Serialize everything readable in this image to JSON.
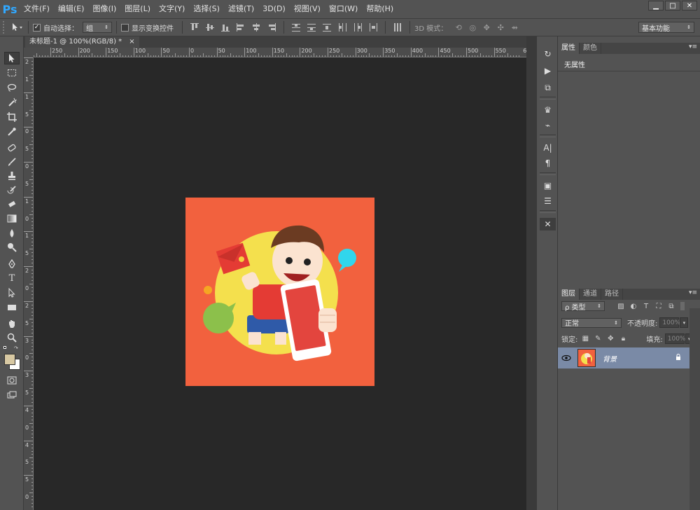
{
  "app": {
    "logo": "Ps"
  },
  "menu": [
    "文件(F)",
    "编辑(E)",
    "图像(I)",
    "图层(L)",
    "文字(Y)",
    "选择(S)",
    "滤镜(T)",
    "3D(D)",
    "视图(V)",
    "窗口(W)",
    "帮助(H)"
  ],
  "window_controls": {
    "minimize": "▁",
    "maximize": "□",
    "close": "✕"
  },
  "options": {
    "auto_select_label": "自动选择：",
    "auto_select_value": "组",
    "show_transform_label": "显示变换控件",
    "mode_3d_label": "3D 模式：",
    "workspace": "基本功能"
  },
  "document": {
    "tab_title": "未标题-1 @ 100%(RGB/8) *",
    "tab_close": "×"
  },
  "ruler": {
    "top_labels": [
      "250",
      "200",
      "150",
      "100",
      "50",
      "0",
      "50",
      "100",
      "150",
      "200",
      "250",
      "300",
      "350",
      "400",
      "450",
      "500",
      "550",
      "60"
    ],
    "left_labels": [
      "2",
      "1",
      "1",
      "5",
      "0",
      "5",
      "0",
      "5",
      "1",
      "0",
      "1",
      "5",
      "2",
      "0",
      "2",
      "5",
      "3",
      "0",
      "3",
      "5",
      "4",
      "0",
      "4",
      "5",
      "5",
      "0"
    ]
  },
  "panels": {
    "properties": {
      "tabs": [
        "属性",
        "颜色"
      ],
      "content": "无属性"
    },
    "layers": {
      "tabs": [
        "图层",
        "通道",
        "路径"
      ],
      "filter_label": "ρ 类型",
      "blend_mode": "正常",
      "opacity_label": "不透明度:",
      "opacity_value": "100%",
      "lock_label": "锁定:",
      "fill_label": "填充:",
      "fill_value": "100%",
      "items": [
        {
          "name": "背景"
        }
      ]
    }
  },
  "colors": {
    "artwork_bg": "#f2613e",
    "circle": "#f4e04d",
    "phone": "#e3453e",
    "bubble_green": "#8cc04b",
    "bubble_cyan": "#31d6ec",
    "layer_selected": "#7a8aa6",
    "ui_gray": "#535353"
  }
}
